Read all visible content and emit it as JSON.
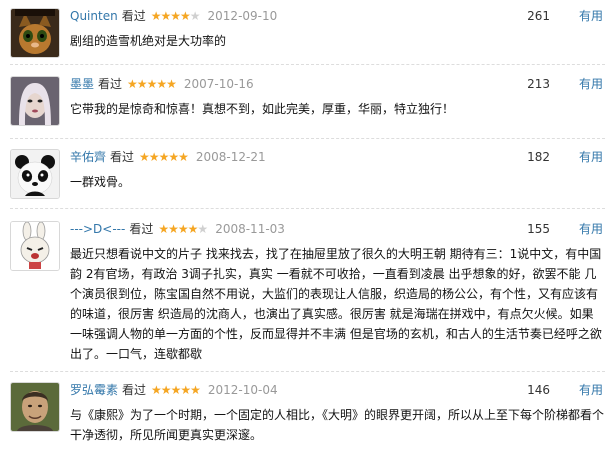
{
  "reviews": [
    {
      "user": "Quinten",
      "action": "看过",
      "stars": 4,
      "date": "2012-09-10",
      "votes": "261",
      "useful": "有用",
      "text": "剧组的造雪机绝对是大功率的",
      "avatar": "puss-in-boots-avatar"
    },
    {
      "user": "墨墨",
      "action": "看过",
      "stars": 5,
      "date": "2007-10-16",
      "votes": "213",
      "useful": "有用",
      "text": "它带我的是惊奇和惊喜！真想不到，如此完美，厚重，华丽，特立独行！",
      "avatar": "woman-portrait-avatar"
    },
    {
      "user": "辛佑齊",
      "action": "看过",
      "stars": 5,
      "date": "2008-12-21",
      "votes": "182",
      "useful": "有用",
      "text": "一群戏骨。",
      "avatar": "panda-avatar"
    },
    {
      "user": "--->D<---",
      "action": "看过",
      "stars": 4,
      "date": "2008-11-03",
      "votes": "155",
      "useful": "有用",
      "text": "最近只想看说中文的片子 找来找去，找了在抽屉里放了很久的大明王朝 期待有三：1说中文，有中国韵 2有官场，有政治 3调子扎实，真实 一看就不可收拾，一直看到凌晨 出乎想象的好，欲罢不能 几个演员很到位，陈宝国自然不用说，大监们的表现让人信服，织造局的杨公公，有个性，又有应该有的味道，很厉害 织造局的沈商人，也演出了真实感。很厉害 就是海瑞在拼戏中，有点欠火候。如果一味强调人物的单一方面的个性，反而显得并不丰满 但是官场的玄机，和古人的生活节奏已经呼之欲出了。一口气，连歇都歇",
      "avatar": "cartoon-rabbit-avatar"
    },
    {
      "user": "罗弘霉素",
      "action": "看过",
      "stars": 5,
      "date": "2012-10-04",
      "votes": "146",
      "useful": "有用",
      "text": "与《康熙》为了一个时期，一个固定的人相比，《大明》的眼界更开阔，所以从上至下每个阶梯都看个干净透彻，所见所闻更真实更深邃。",
      "avatar": "man-portrait-avatar"
    }
  ],
  "colors": {
    "link": "#3377aa",
    "star": "#f5a623",
    "date": "#999999"
  }
}
